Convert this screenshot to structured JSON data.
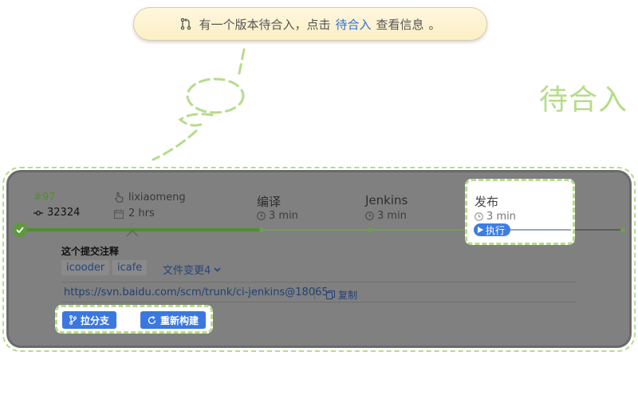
{
  "notification": {
    "prefix": "有一个版本待合入，点击",
    "link": "待合入",
    "suffix": "查看信息",
    "end": "。"
  },
  "side_label": "待合入",
  "pipeline": {
    "build_id": "#97",
    "commit": "32324",
    "author": "lixiaomeng",
    "duration": "2 hrs",
    "stages": [
      {
        "name": "编译",
        "time": "3 min"
      },
      {
        "name": "Jenkins",
        "time": "3 min"
      },
      {
        "name": "发布",
        "time": "3 min",
        "action": "执行"
      }
    ],
    "detail": {
      "title": "这个提交注释",
      "tags": [
        "icooder",
        "icafe"
      ],
      "file_change": "文件变更4",
      "repo_url": "https://svn.baidu.com/scm/trunk/ci-jenkins@18065",
      "copy_label": "复制"
    },
    "actions": {
      "branch_label": "拉分支",
      "rebuild_label": "重新构建"
    }
  },
  "colors": {
    "accent_green": "#b6dc8a",
    "link_blue": "#2f6fd6",
    "button_blue": "#3a78e0",
    "overlay_gray": "#808080"
  }
}
